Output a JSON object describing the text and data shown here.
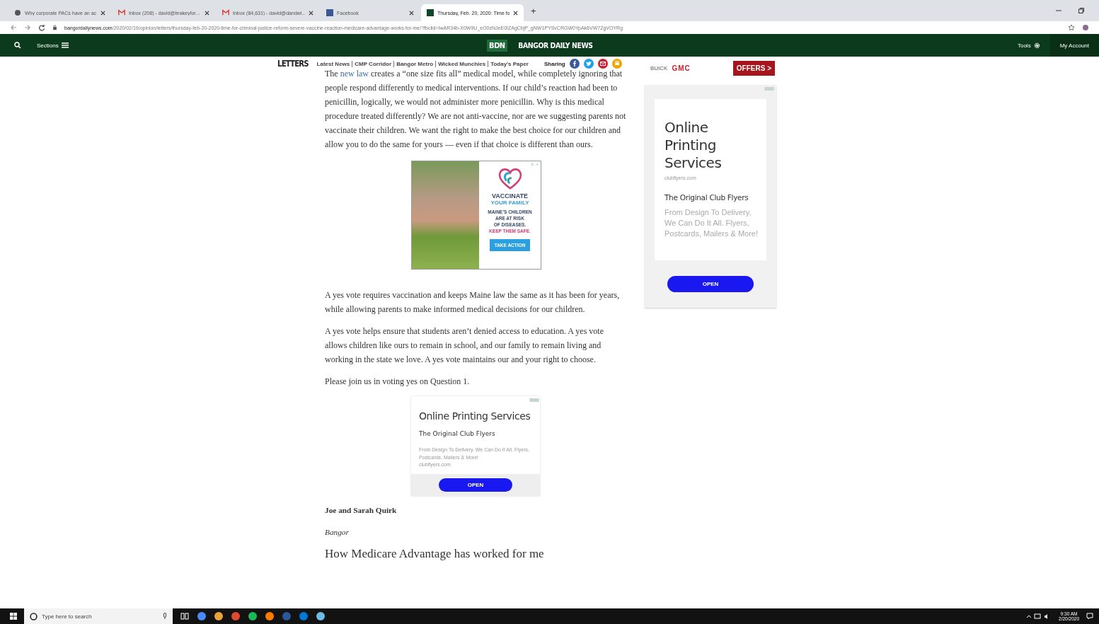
{
  "browser": {
    "tabs": [
      {
        "title": "Why corporate PACs have an ac",
        "kind": "site",
        "selected": false
      },
      {
        "title": "Inbox (208) - david@brakeyfor...",
        "kind": "mail",
        "selected": false
      },
      {
        "title": "Inbox (84,631) - david@dandwi...",
        "kind": "mail",
        "selected": false
      },
      {
        "title": "Facebook",
        "kind": "facebook",
        "selected": false
      },
      {
        "title": "Thursday, Feb. 20, 2020: Time fo",
        "kind": "bdn",
        "selected": true
      }
    ],
    "new_tab": "+",
    "url_host": "bangordailynews.com",
    "url_path": "/2020/02/19/opinion/letters/thursday-feb-20-2020-time-for-criminal-justice-reform-severe-vaccine-reaction-medicare-advantage-works-for-me/?fbclid=IwAR34b-X0W9U_eO0zNJeE0IZAgCbjP_gNW1PYSvCRGW0YpAk6VW7ZgVOYRg"
  },
  "site_header": {
    "sections": "Sections",
    "logo_badge": "BDN",
    "logo_text": "BANGOR DAILY NEWS",
    "tools": "Tools",
    "account": "My Account"
  },
  "section_nav": {
    "section": "LETTERS",
    "links": [
      "Latest News",
      "CMP Corridor",
      "Bangor Metro",
      "Wicked Munchies",
      "Today's Paper"
    ],
    "sharing": "Sharing",
    "share_icons": [
      {
        "kind": "facebook",
        "color": "#3b5998"
      },
      {
        "kind": "twitter",
        "color": "#1da1f2"
      },
      {
        "kind": "email",
        "color": "#d0202f"
      },
      {
        "kind": "print",
        "color": "#f0a500"
      }
    ]
  },
  "article": {
    "intro": {
      "before": "The ",
      "link": "new law",
      "after": " creates a “one size fits all” medical model, while completely ignoring that people respond differently to medical interventions. If our child’s reaction had been to penicillin, logically, we would not administer more penicillin. Why is this medical procedure treated differently? We are not anti-vaccine, nor are we suggesting parents not vaccinate their children. We want the right to make the best choice for our children and allow you to do the same for yours — even if that choice is different than ours."
    },
    "vaccine_ad": {
      "title": "VACCINATE",
      "subtitle": "YOUR FAMILY",
      "lines": [
        "MAINE’S CHILDREN",
        "ARE AT RISK",
        "OF DISEASES."
      ],
      "highlight": "KEEP THEM SAFE.",
      "button": "TAKE ACTION"
    },
    "paragraphs": [
      "A yes vote requires vaccination and keeps Maine law the same as it has been for years, while allowing parents to make informed medical decisions for our children.",
      "A yes vote helps ensure that students aren’t denied access to education. A yes vote allows children like ours to remain in school, and our family to remain living and working in the state we love. A yes vote maintains our and your right to choose.",
      "Please join us in voting yes on Question 1."
    ],
    "inline_ad": {
      "title": "Online Printing Services",
      "subtitle": "The Original Club Flyers",
      "body": "From Design To Delivery, We Can Do It All. Flyers, Postcards, Mailers & More!",
      "domain": "clubflyers.com",
      "button": "OPEN"
    },
    "signature": "Joe and Sarah Quirk",
    "location": "Bangor",
    "next_heading": "How Medicare Advantage has worked for me"
  },
  "sidebar": {
    "car_ad": {
      "brand_1": "BUICK",
      "brand_2": "GMC",
      "button": "OFFERS >"
    },
    "print_ad": {
      "title": "Online Printing Services",
      "domain": "clubflyers.com",
      "subtitle": "The Original Club Flyers",
      "body": "From Design To Delivery, We Can Do It All. Flyers, Postcards, Mailers & More!",
      "button": "OPEN"
    }
  },
  "taskbar": {
    "search_placeholder": "Type here to search",
    "time": "9:30 AM",
    "date": "2/20/2020"
  }
}
